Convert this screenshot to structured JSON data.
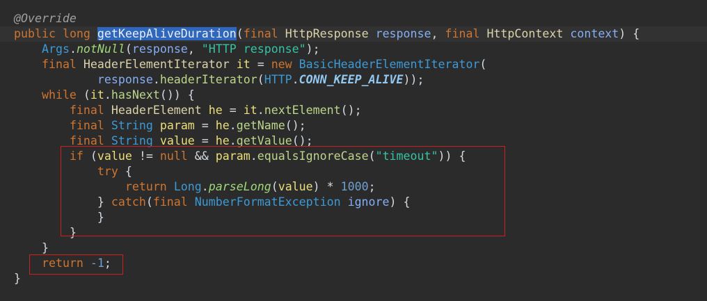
{
  "editor": {
    "colors": {
      "background": "#2b2b2b",
      "current-line": "#323232",
      "selection": "#2e67bd",
      "selection-text": "#e9eef6",
      "highlight-box": "#d11f1f",
      "annotation": "#a0a0a0",
      "keyword": "#cf7530",
      "class-name": "#3d9ad6",
      "interface-name": "#dcd3a8",
      "parameter-name": "#86aef5",
      "variable-name": "#ecdf7a",
      "method-call": "#bcd68a",
      "static-method-call": "#9fd77a",
      "constant-name": "#93c9f0",
      "string-literal": "#35c3a2",
      "number-literal": "#6f9fd0",
      "code-text": "#d4dbe2"
    },
    "lines": [
      {
        "tokens": [
          {
            "annotation": "@Override"
          }
        ]
      },
      {
        "current": true,
        "tokens": [
          {
            "keyword": "public"
          },
          {
            "code-text": " "
          },
          {
            "keyword": "long"
          },
          {
            "code-text": " "
          },
          {
            "method-name": "getKeepAliveDuration",
            "selected": true
          },
          {
            "code-text": "("
          },
          {
            "keyword": "final"
          },
          {
            "code-text": " "
          },
          {
            "interface-name": "HttpResponse"
          },
          {
            "code-text": " "
          },
          {
            "parameter-name": "response"
          },
          {
            "code-text": ", "
          },
          {
            "keyword": "final"
          },
          {
            "code-text": " "
          },
          {
            "interface-name": "HttpContext"
          },
          {
            "code-text": " "
          },
          {
            "parameter-name": "context"
          },
          {
            "code-text": ") {"
          }
        ]
      },
      {
        "tokens": [
          {
            "indent": "    "
          },
          {
            "class-name": "Args"
          },
          {
            "code-text": "."
          },
          {
            "static-method-call": "notNull"
          },
          {
            "code-text": "("
          },
          {
            "parameter-name": "response"
          },
          {
            "code-text": ", "
          },
          {
            "string-literal": "\"HTTP response\""
          },
          {
            "code-text": ");"
          }
        ]
      },
      {
        "tokens": [
          {
            "indent": "    "
          },
          {
            "keyword": "final"
          },
          {
            "code-text": " "
          },
          {
            "interface-name": "HeaderElementIterator"
          },
          {
            "code-text": " "
          },
          {
            "variable-name": "it"
          },
          {
            "code-text": " = "
          },
          {
            "keyword": "new"
          },
          {
            "code-text": " "
          },
          {
            "class-name": "BasicHeaderElementIterator"
          },
          {
            "code-text": "("
          }
        ]
      },
      {
        "tokens": [
          {
            "indent": "            "
          },
          {
            "parameter-name": "response"
          },
          {
            "code-text": "."
          },
          {
            "method-call": "headerIterator"
          },
          {
            "code-text": "("
          },
          {
            "class-name": "HTTP"
          },
          {
            "code-text": "."
          },
          {
            "constant-name": "CONN_KEEP_ALIVE"
          },
          {
            "code-text": "));"
          }
        ]
      },
      {
        "tokens": [
          {
            "indent": "    "
          },
          {
            "keyword": "while"
          },
          {
            "code-text": " ("
          },
          {
            "variable-name": "it"
          },
          {
            "code-text": "."
          },
          {
            "method-call": "hasNext"
          },
          {
            "code-text": "()) {"
          }
        ]
      },
      {
        "tokens": [
          {
            "indent": "        "
          },
          {
            "keyword": "final"
          },
          {
            "code-text": " "
          },
          {
            "interface-name": "HeaderElement"
          },
          {
            "code-text": " "
          },
          {
            "variable-name": "he"
          },
          {
            "code-text": " = "
          },
          {
            "variable-name": "it"
          },
          {
            "code-text": "."
          },
          {
            "method-call": "nextElement"
          },
          {
            "code-text": "();"
          }
        ]
      },
      {
        "tokens": [
          {
            "indent": "        "
          },
          {
            "keyword": "final"
          },
          {
            "code-text": " "
          },
          {
            "class-name": "String"
          },
          {
            "code-text": " "
          },
          {
            "variable-name": "param"
          },
          {
            "code-text": " = "
          },
          {
            "variable-name": "he"
          },
          {
            "code-text": "."
          },
          {
            "method-call": "getName"
          },
          {
            "code-text": "();"
          }
        ]
      },
      {
        "tokens": [
          {
            "indent": "        "
          },
          {
            "keyword": "final"
          },
          {
            "code-text": " "
          },
          {
            "class-name": "String"
          },
          {
            "code-text": " "
          },
          {
            "variable-name": "value"
          },
          {
            "code-text": " = "
          },
          {
            "variable-name": "he"
          },
          {
            "code-text": "."
          },
          {
            "method-call": "getValue"
          },
          {
            "code-text": "();"
          }
        ]
      },
      {
        "tokens": [
          {
            "indent": "        "
          },
          {
            "keyword": "if"
          },
          {
            "code-text": " ("
          },
          {
            "variable-name": "value"
          },
          {
            "code-text": " != "
          },
          {
            "keyword": "null"
          },
          {
            "code-text": " && "
          },
          {
            "variable-name": "param"
          },
          {
            "code-text": "."
          },
          {
            "method-call": "equalsIgnoreCase"
          },
          {
            "code-text": "("
          },
          {
            "string-literal": "\"timeout\""
          },
          {
            "code-text": ")) {"
          }
        ]
      },
      {
        "tokens": [
          {
            "indent": "            "
          },
          {
            "keyword": "try"
          },
          {
            "code-text": " {"
          }
        ]
      },
      {
        "tokens": [
          {
            "indent": "                "
          },
          {
            "keyword": "return"
          },
          {
            "code-text": " "
          },
          {
            "class-name": "Long"
          },
          {
            "code-text": "."
          },
          {
            "static-method-call": "parseLong"
          },
          {
            "code-text": "("
          },
          {
            "variable-name": "value"
          },
          {
            "code-text": ") * "
          },
          {
            "number-literal": "1000"
          },
          {
            "code-text": ";"
          }
        ]
      },
      {
        "tokens": [
          {
            "indent": "            "
          },
          {
            "code-text": "} "
          },
          {
            "keyword": "catch"
          },
          {
            "code-text": "("
          },
          {
            "keyword": "final"
          },
          {
            "code-text": " "
          },
          {
            "class-name": "NumberFormatException"
          },
          {
            "code-text": " "
          },
          {
            "parameter-name": "ignore"
          },
          {
            "code-text": ") {"
          }
        ]
      },
      {
        "tokens": [
          {
            "indent": "            "
          },
          {
            "code-text": "}"
          }
        ]
      },
      {
        "tokens": [
          {
            "indent": "        "
          },
          {
            "code-text": "}"
          }
        ]
      },
      {
        "tokens": [
          {
            "indent": "    "
          },
          {
            "code-text": "}"
          }
        ]
      },
      {
        "tokens": [
          {
            "indent": "    "
          },
          {
            "keyword": "return"
          },
          {
            "code-text": " "
          },
          {
            "number-literal": "-1"
          },
          {
            "code-text": ";"
          }
        ]
      },
      {
        "tokens": [
          {
            "code-text": "}"
          }
        ]
      }
    ]
  }
}
